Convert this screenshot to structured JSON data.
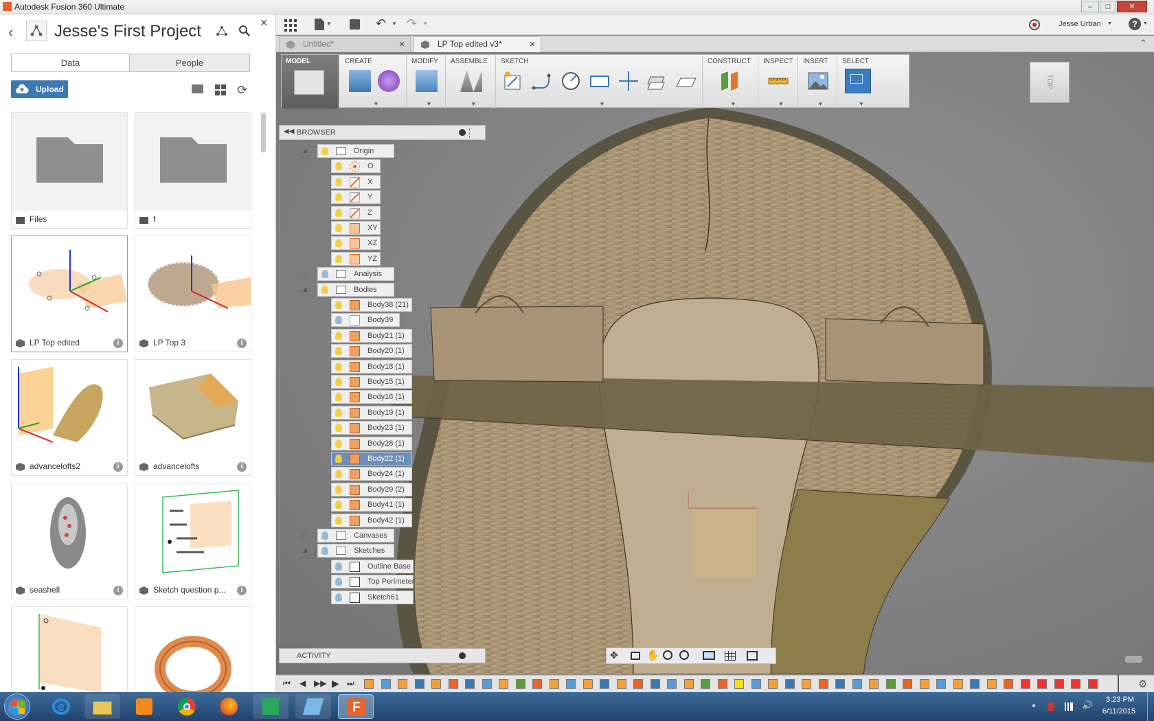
{
  "window": {
    "title": "Autodesk Fusion 360 Ultimate"
  },
  "left_panel": {
    "project_title": "Jesse's First Project",
    "tabs": [
      "Data",
      "People"
    ],
    "upload_label": "Upload",
    "items": [
      {
        "name": "Files",
        "kind": "folder"
      },
      {
        "name": "f",
        "kind": "folder"
      },
      {
        "name": "LP Top edited",
        "kind": "design"
      },
      {
        "name": "LP Top 3",
        "kind": "design"
      },
      {
        "name": "advancelofts2",
        "kind": "design"
      },
      {
        "name": "advancelofts",
        "kind": "design"
      },
      {
        "name": "seashell",
        "kind": "design"
      },
      {
        "name": "Sketch question p...",
        "kind": "design"
      }
    ]
  },
  "menubar": {
    "user": "Jesse Urban",
    "help": "?"
  },
  "doc_tabs": [
    {
      "label": "Untitled*",
      "active": false
    },
    {
      "label": "LP Top edited v3*",
      "active": true
    }
  ],
  "toolbar": {
    "workspace": "MODEL",
    "groups": [
      "CREATE",
      "MODIFY",
      "ASSEMBLE",
      "SKETCH",
      "CONSTRUCT",
      "INSPECT",
      "INSERT",
      "SELECT"
    ]
  },
  "browser": {
    "title": "BROWSER",
    "activity": "ACTIVITY",
    "nodes": [
      {
        "label": "Origin",
        "type": "folder"
      },
      {
        "label": "O",
        "type": "point"
      },
      {
        "label": "X",
        "type": "axis"
      },
      {
        "label": "Y",
        "type": "axis"
      },
      {
        "label": "Z",
        "type": "axis"
      },
      {
        "label": "XY",
        "type": "plane"
      },
      {
        "label": "XZ",
        "type": "plane"
      },
      {
        "label": "YZ",
        "type": "plane"
      },
      {
        "label": "Analysis",
        "type": "folder"
      },
      {
        "label": "Bodies",
        "type": "folder"
      },
      {
        "label": "Body38 (21)",
        "type": "body"
      },
      {
        "label": "Body39",
        "type": "body-hidden"
      },
      {
        "label": "Body21 (1)",
        "type": "body"
      },
      {
        "label": "Body20 (1)",
        "type": "body"
      },
      {
        "label": "Body18 (1)",
        "type": "body"
      },
      {
        "label": "Body15 (1)",
        "type": "body"
      },
      {
        "label": "Body16 (1)",
        "type": "body"
      },
      {
        "label": "Body19 (1)",
        "type": "body"
      },
      {
        "label": "Body23 (1)",
        "type": "body"
      },
      {
        "label": "Body28 (1)",
        "type": "body"
      },
      {
        "label": "Body22 (1)",
        "type": "body",
        "selected": true
      },
      {
        "label": "Body24 (1)",
        "type": "body"
      },
      {
        "label": "Body29 (2)",
        "type": "body"
      },
      {
        "label": "Body41 (1)",
        "type": "body"
      },
      {
        "label": "Body42 (1)",
        "type": "body"
      },
      {
        "label": "Canvases",
        "type": "folder"
      },
      {
        "label": "Sketches",
        "type": "folder"
      },
      {
        "label": "Outline Base",
        "type": "sketch"
      },
      {
        "label": "Top Perimeter",
        "type": "sketch"
      },
      {
        "label": "Sketch61",
        "type": "sketch"
      }
    ]
  },
  "viewcube": {
    "label": "TOP"
  },
  "taskbar": {
    "time": "3:23 PM",
    "date": "6/11/2015"
  }
}
